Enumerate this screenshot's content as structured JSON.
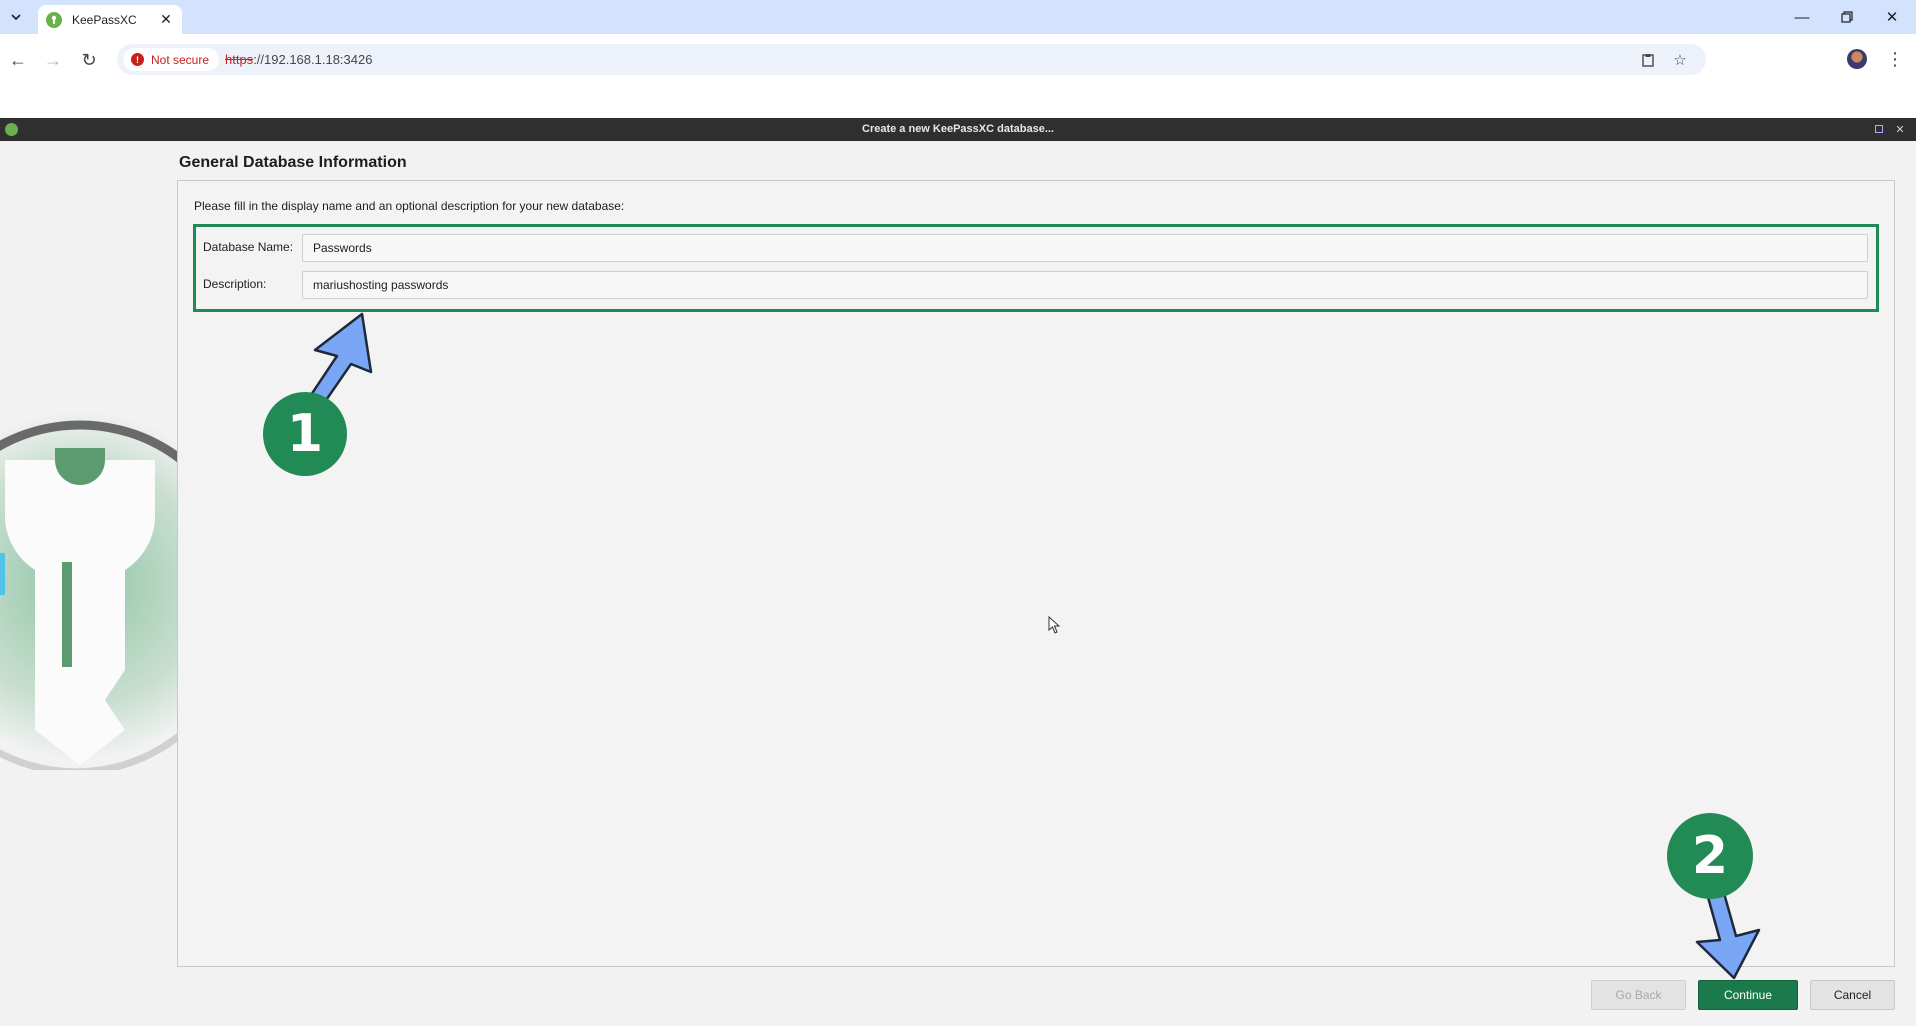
{
  "browser": {
    "tab_title": "KeePassXC",
    "security_label": "Not secure",
    "url_scheme": "https",
    "url_rest": "://192.168.1.18:3426"
  },
  "window": {
    "title": "Create a new KeePassXC database..."
  },
  "wizard": {
    "heading": "General Database Information",
    "instructions": "Please fill in the display name and an optional description for your new database:",
    "name_label": "Database Name:",
    "name_value": "Passwords",
    "description_label": "Description:",
    "description_value": "mariushosting passwords"
  },
  "buttons": {
    "go_back": "Go Back",
    "continue": "Continue",
    "cancel": "Cancel"
  },
  "annotations": {
    "step1": "1",
    "step2": "2"
  },
  "colors": {
    "accent_green": "#1f8a55",
    "arrow_blue": "#7aa7f5"
  }
}
